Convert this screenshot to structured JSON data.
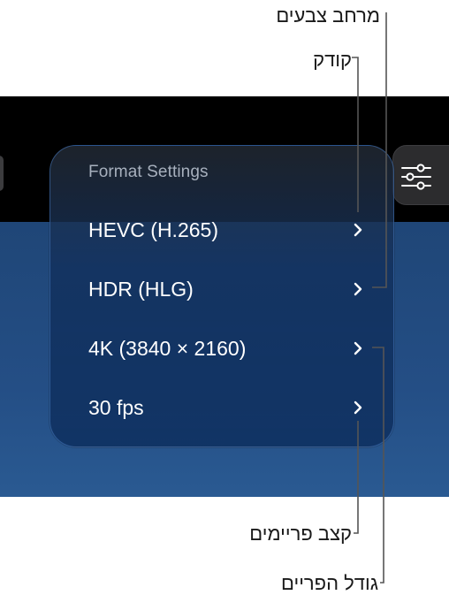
{
  "panel": {
    "title": "Format Settings",
    "rows": [
      {
        "label": "HEVC (H.265)"
      },
      {
        "label": "HDR (HLG)"
      },
      {
        "label": "4K (3840 × 2160)"
      },
      {
        "label": "30 fps"
      }
    ]
  },
  "callouts": {
    "color_space": "מרחב צבעים",
    "codec": "קודק",
    "frame_rate": "קצב פריימים",
    "frame_size": "גודל הפריים"
  },
  "icons": {
    "settings": "sliders-icon",
    "chevron": "chevron-right-icon"
  },
  "colors": {
    "panel_bg": "#12305c",
    "screen_blue": "#244e85",
    "leader_line": "#555555"
  }
}
